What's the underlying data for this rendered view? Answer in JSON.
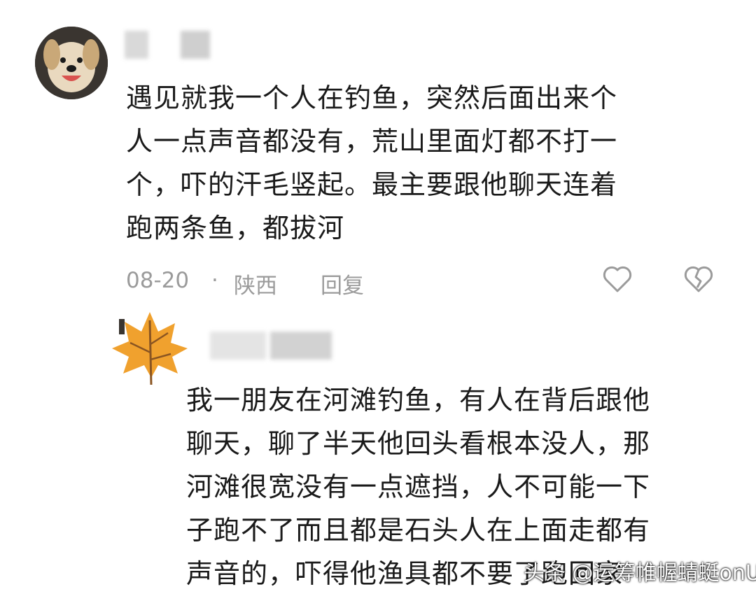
{
  "comment": {
    "lines": [
      "遇见就我一个人在钓鱼，突然后面出来个",
      "人一点声音都没有，荒山里面灯都不打一",
      "个，吓的汗毛竖起。最主要跟他聊天连着",
      "跑两条鱼，都拔河"
    ],
    "date": "08-20",
    "separator": "·",
    "location": "陕西",
    "reply_label": "回复"
  },
  "reply": {
    "lines": [
      "我一朋友在河滩钓鱼，有人在背后跟他",
      "聊天，聊了半天他回头看根本没人，那",
      "河滩很宽没有一点遮挡，人不可能一下",
      "子跑不了而且都是石头人在上面走都有",
      "声音的，吓得他渔具都不要了跑回家"
    ]
  },
  "watermark": "头条 @运筹帷幄蜻蜓onU",
  "colors": {
    "text": "#1a1a1a",
    "meta": "#9b9b9b",
    "leaf": "#f0a12e"
  }
}
